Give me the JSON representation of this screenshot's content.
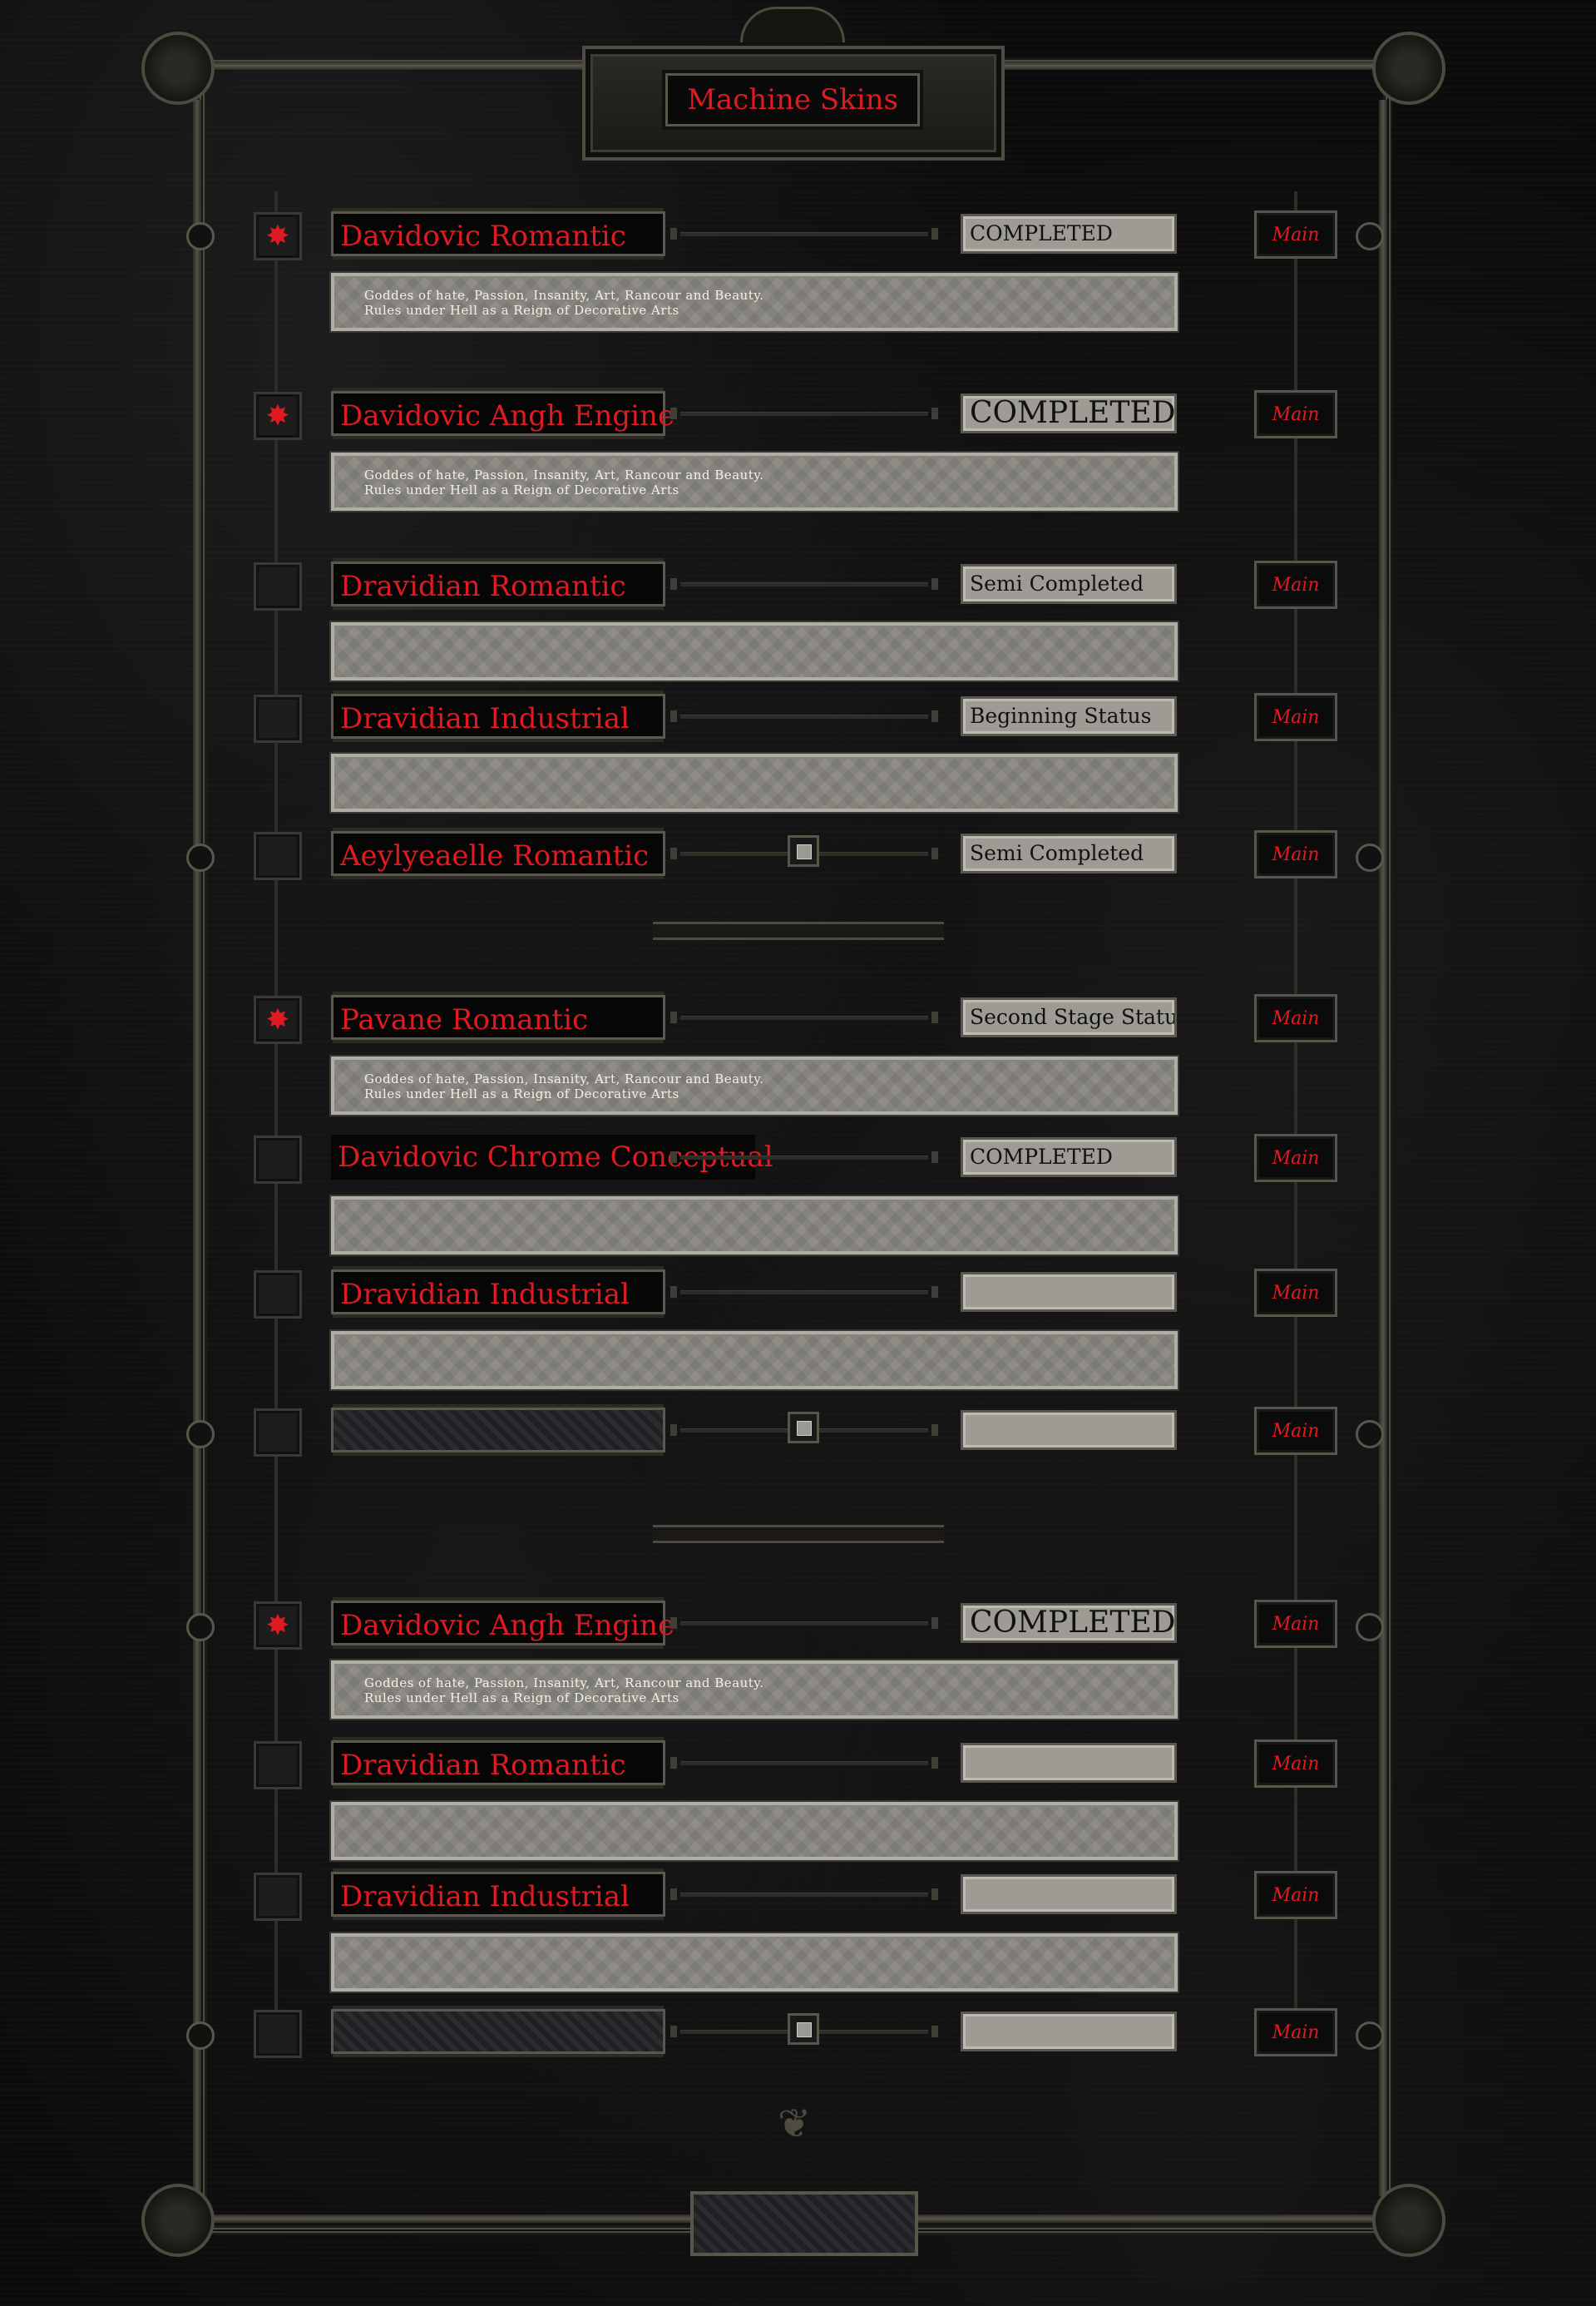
{
  "title": "Machine Skins",
  "rows": [
    {
      "name": "Davidovic Romantic",
      "status": "COMPLETED",
      "main": "Main",
      "checked": true,
      "desc_line1": "Goddes of hate, Passion, Insanity, Art, Rancour and Beauty.",
      "desc_line2": "Rules under Hell as a Reign of Decorative Arts"
    },
    {
      "name": "Davidovic Angh Engine",
      "status": "COMPLETED",
      "main": "Main",
      "checked": true,
      "desc_line1": "Goddes of hate, Passion, Insanity, Art, Rancour and Beauty.",
      "desc_line2": "Rules under Hell as a Reign of Decorative Arts"
    },
    {
      "name": "Dravidian Romantic",
      "status": "Semi Completed",
      "main": "Main",
      "checked": false
    },
    {
      "name": "Dravidian Industrial",
      "status": "Beginning Status",
      "main": "Main",
      "checked": false
    },
    {
      "name": "Aeylyeaelle Romantic",
      "status": "Semi Completed",
      "main": "Main",
      "checked": false
    },
    {
      "name": "Pavane Romantic",
      "status": "Second Stage Status",
      "main": "Main",
      "checked": true,
      "desc_line1": "Goddes of hate, Passion, Insanity, Art, Rancour and Beauty.",
      "desc_line2": "Rules under Hell as a Reign of Decorative Arts"
    },
    {
      "name": "Davidovic Chrome Conceptual",
      "status": "COMPLETED",
      "main": "Main",
      "checked": false
    },
    {
      "name": "Dravidian Industrial",
      "status": "",
      "main": "Main",
      "checked": false
    },
    {
      "name": "",
      "status": "",
      "main": "Main",
      "checked": false
    },
    {
      "name": "Davidovic Angh Engine",
      "status": "COMPLETED",
      "main": "Main",
      "checked": true,
      "desc_line1": "Goddes of hate, Passion, Insanity, Art, Rancour and Beauty.",
      "desc_line2": "Rules under Hell as a Reign of Decorative Arts"
    },
    {
      "name": "Dravidian Romantic",
      "status": "",
      "main": "Main",
      "checked": false
    },
    {
      "name": "Dravidian Industrial",
      "status": "",
      "main": "Main",
      "checked": false
    },
    {
      "name": "",
      "status": "",
      "main": "Main",
      "checked": false
    }
  ],
  "colors": {
    "accent": "#e01a22",
    "frame": "#4d4a3f",
    "panel": "#9d9b94"
  },
  "icons": {
    "checked": "red-star-icon",
    "slider": "slider-knob-icon"
  }
}
